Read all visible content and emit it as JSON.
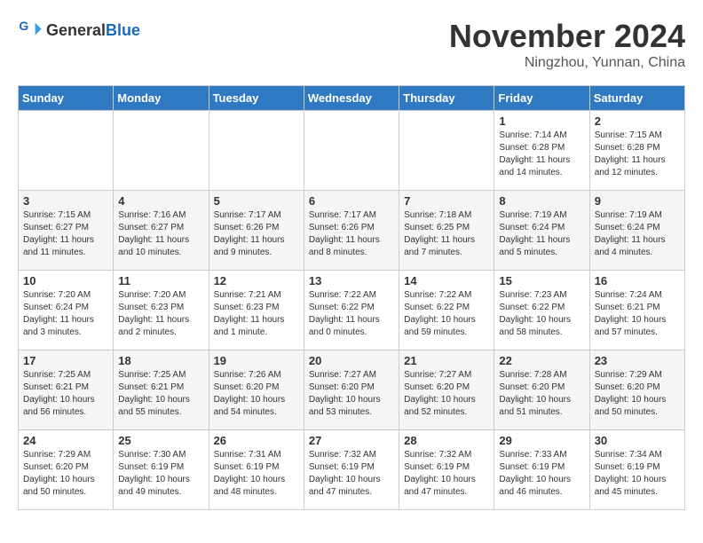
{
  "header": {
    "logo_general": "General",
    "logo_blue": "Blue",
    "month": "November 2024",
    "location": "Ningzhou, Yunnan, China"
  },
  "weekdays": [
    "Sunday",
    "Monday",
    "Tuesday",
    "Wednesday",
    "Thursday",
    "Friday",
    "Saturday"
  ],
  "weeks": [
    [
      {
        "day": "",
        "info": ""
      },
      {
        "day": "",
        "info": ""
      },
      {
        "day": "",
        "info": ""
      },
      {
        "day": "",
        "info": ""
      },
      {
        "day": "",
        "info": ""
      },
      {
        "day": "1",
        "info": "Sunrise: 7:14 AM\nSunset: 6:28 PM\nDaylight: 11 hours and 14 minutes."
      },
      {
        "day": "2",
        "info": "Sunrise: 7:15 AM\nSunset: 6:28 PM\nDaylight: 11 hours and 12 minutes."
      }
    ],
    [
      {
        "day": "3",
        "info": "Sunrise: 7:15 AM\nSunset: 6:27 PM\nDaylight: 11 hours and 11 minutes."
      },
      {
        "day": "4",
        "info": "Sunrise: 7:16 AM\nSunset: 6:27 PM\nDaylight: 11 hours and 10 minutes."
      },
      {
        "day": "5",
        "info": "Sunrise: 7:17 AM\nSunset: 6:26 PM\nDaylight: 11 hours and 9 minutes."
      },
      {
        "day": "6",
        "info": "Sunrise: 7:17 AM\nSunset: 6:26 PM\nDaylight: 11 hours and 8 minutes."
      },
      {
        "day": "7",
        "info": "Sunrise: 7:18 AM\nSunset: 6:25 PM\nDaylight: 11 hours and 7 minutes."
      },
      {
        "day": "8",
        "info": "Sunrise: 7:19 AM\nSunset: 6:24 PM\nDaylight: 11 hours and 5 minutes."
      },
      {
        "day": "9",
        "info": "Sunrise: 7:19 AM\nSunset: 6:24 PM\nDaylight: 11 hours and 4 minutes."
      }
    ],
    [
      {
        "day": "10",
        "info": "Sunrise: 7:20 AM\nSunset: 6:24 PM\nDaylight: 11 hours and 3 minutes."
      },
      {
        "day": "11",
        "info": "Sunrise: 7:20 AM\nSunset: 6:23 PM\nDaylight: 11 hours and 2 minutes."
      },
      {
        "day": "12",
        "info": "Sunrise: 7:21 AM\nSunset: 6:23 PM\nDaylight: 11 hours and 1 minute."
      },
      {
        "day": "13",
        "info": "Sunrise: 7:22 AM\nSunset: 6:22 PM\nDaylight: 11 hours and 0 minutes."
      },
      {
        "day": "14",
        "info": "Sunrise: 7:22 AM\nSunset: 6:22 PM\nDaylight: 10 hours and 59 minutes."
      },
      {
        "day": "15",
        "info": "Sunrise: 7:23 AM\nSunset: 6:22 PM\nDaylight: 10 hours and 58 minutes."
      },
      {
        "day": "16",
        "info": "Sunrise: 7:24 AM\nSunset: 6:21 PM\nDaylight: 10 hours and 57 minutes."
      }
    ],
    [
      {
        "day": "17",
        "info": "Sunrise: 7:25 AM\nSunset: 6:21 PM\nDaylight: 10 hours and 56 minutes."
      },
      {
        "day": "18",
        "info": "Sunrise: 7:25 AM\nSunset: 6:21 PM\nDaylight: 10 hours and 55 minutes."
      },
      {
        "day": "19",
        "info": "Sunrise: 7:26 AM\nSunset: 6:20 PM\nDaylight: 10 hours and 54 minutes."
      },
      {
        "day": "20",
        "info": "Sunrise: 7:27 AM\nSunset: 6:20 PM\nDaylight: 10 hours and 53 minutes."
      },
      {
        "day": "21",
        "info": "Sunrise: 7:27 AM\nSunset: 6:20 PM\nDaylight: 10 hours and 52 minutes."
      },
      {
        "day": "22",
        "info": "Sunrise: 7:28 AM\nSunset: 6:20 PM\nDaylight: 10 hours and 51 minutes."
      },
      {
        "day": "23",
        "info": "Sunrise: 7:29 AM\nSunset: 6:20 PM\nDaylight: 10 hours and 50 minutes."
      }
    ],
    [
      {
        "day": "24",
        "info": "Sunrise: 7:29 AM\nSunset: 6:20 PM\nDaylight: 10 hours and 50 minutes."
      },
      {
        "day": "25",
        "info": "Sunrise: 7:30 AM\nSunset: 6:19 PM\nDaylight: 10 hours and 49 minutes."
      },
      {
        "day": "26",
        "info": "Sunrise: 7:31 AM\nSunset: 6:19 PM\nDaylight: 10 hours and 48 minutes."
      },
      {
        "day": "27",
        "info": "Sunrise: 7:32 AM\nSunset: 6:19 PM\nDaylight: 10 hours and 47 minutes."
      },
      {
        "day": "28",
        "info": "Sunrise: 7:32 AM\nSunset: 6:19 PM\nDaylight: 10 hours and 47 minutes."
      },
      {
        "day": "29",
        "info": "Sunrise: 7:33 AM\nSunset: 6:19 PM\nDaylight: 10 hours and 46 minutes."
      },
      {
        "day": "30",
        "info": "Sunrise: 7:34 AM\nSunset: 6:19 PM\nDaylight: 10 hours and 45 minutes."
      }
    ]
  ]
}
